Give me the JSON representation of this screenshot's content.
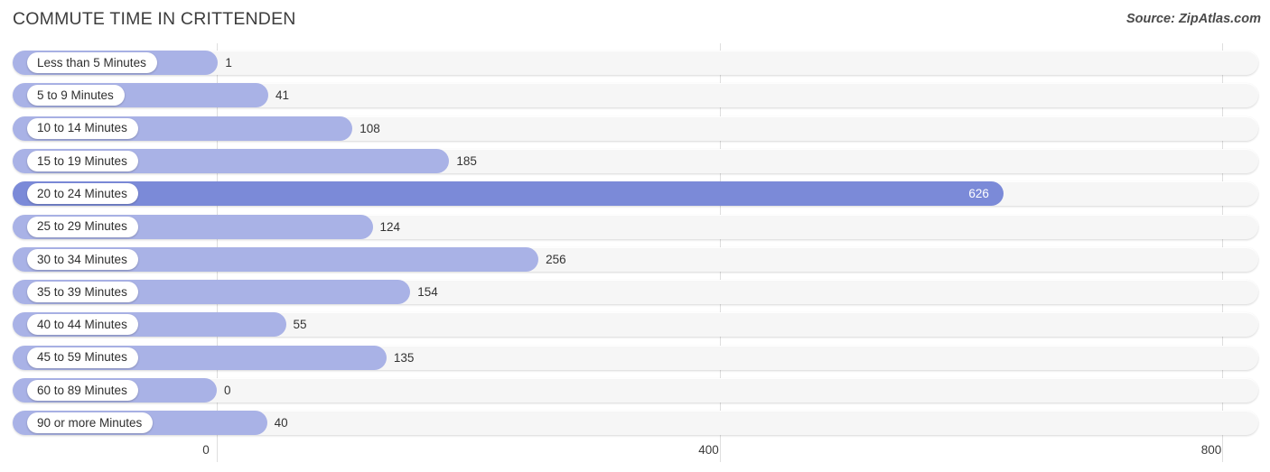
{
  "header": {
    "title": "COMMUTE TIME IN CRITTENDEN",
    "source": "Source: ZipAtlas.com"
  },
  "chart_data": {
    "type": "bar",
    "orientation": "horizontal",
    "title": "COMMUTE TIME IN CRITTENDEN",
    "subtitle": "",
    "xlabel": "",
    "ylabel": "",
    "xlim": [
      0,
      800
    ],
    "ticks": [
      "0",
      "400",
      "800"
    ],
    "tick_values": [
      0,
      400,
      800
    ],
    "grid": true,
    "legend": false,
    "highlight_category": "20 to 24 Minutes",
    "colors": {
      "bar": "#a9b2e6",
      "bar_highlight": "#7b8ad8",
      "track": "#f6f6f6",
      "pill": "#ffffff",
      "gridline": "#dedede",
      "text": "#333333",
      "value_inside_text": "#ffffff"
    },
    "categories": [
      "Less than 5 Minutes",
      "5 to 9 Minutes",
      "10 to 14 Minutes",
      "15 to 19 Minutes",
      "20 to 24 Minutes",
      "25 to 29 Minutes",
      "30 to 34 Minutes",
      "35 to 39 Minutes",
      "40 to 44 Minutes",
      "45 to 59 Minutes",
      "60 to 89 Minutes",
      "90 or more Minutes"
    ],
    "values": [
      1,
      41,
      108,
      185,
      626,
      124,
      256,
      154,
      55,
      135,
      0,
      40
    ],
    "value_labels": [
      "1",
      "41",
      "108",
      "185",
      "626",
      "124",
      "256",
      "154",
      "55",
      "135",
      "0",
      "40"
    ],
    "rows": [
      {
        "label": "Less than 5 Minutes",
        "value": 1,
        "value_label": "1",
        "highlight": false
      },
      {
        "label": "5 to 9 Minutes",
        "value": 41,
        "value_label": "41",
        "highlight": false
      },
      {
        "label": "10 to 14 Minutes",
        "value": 108,
        "value_label": "108",
        "highlight": false
      },
      {
        "label": "15 to 19 Minutes",
        "value": 185,
        "value_label": "185",
        "highlight": false
      },
      {
        "label": "20 to 24 Minutes",
        "value": 626,
        "value_label": "626",
        "highlight": true
      },
      {
        "label": "25 to 29 Minutes",
        "value": 124,
        "value_label": "124",
        "highlight": false
      },
      {
        "label": "30 to 34 Minutes",
        "value": 256,
        "value_label": "256",
        "highlight": false
      },
      {
        "label": "35 to 39 Minutes",
        "value": 154,
        "value_label": "154",
        "highlight": false
      },
      {
        "label": "40 to 44 Minutes",
        "value": 55,
        "value_label": "55",
        "highlight": false
      },
      {
        "label": "45 to 59 Minutes",
        "value": 135,
        "value_label": "135",
        "highlight": false
      },
      {
        "label": "60 to 89 Minutes",
        "value": 0,
        "value_label": "0",
        "highlight": false
      },
      {
        "label": "90 or more Minutes",
        "value": 40,
        "value_label": "40",
        "highlight": false
      }
    ]
  }
}
